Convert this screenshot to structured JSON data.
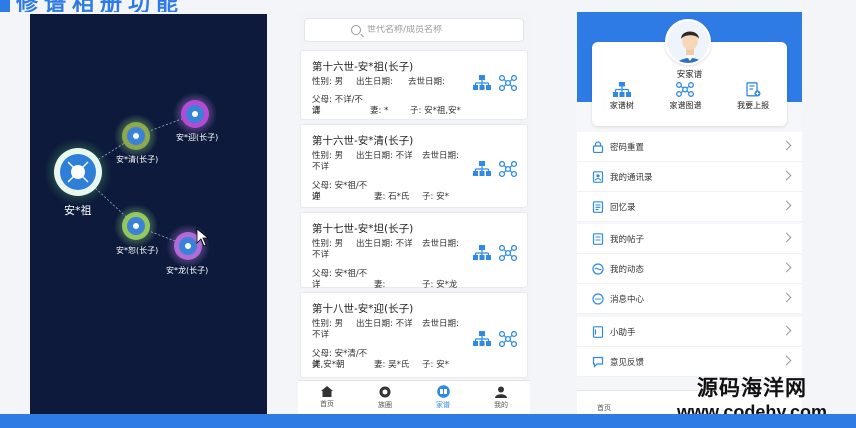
{
  "banner": {
    "title": "修谱相册功能"
  },
  "tree": {
    "nodes": [
      {
        "id": "root",
        "label": "安*祖"
      },
      {
        "id": "n1",
        "label": "安*清(长子)"
      },
      {
        "id": "n2",
        "label": "安*迎(长子)"
      },
      {
        "id": "n3",
        "label": "安*恕(长子)"
      },
      {
        "id": "n4",
        "label": "安*龙(长子)"
      }
    ]
  },
  "search": {
    "placeholder": "世代名称/成员名称"
  },
  "cards": [
    {
      "title": "第十六世-安*祖(长子)",
      "line1": [
        "性别: 男",
        "出生日期:",
        "去世日期:"
      ],
      "line2": [
        "父母: 不详/不详",
        "妻: *",
        "子: 安*祖,安*"
      ],
      "line2b": "清"
    },
    {
      "title": "第十六世-安*清(长子)",
      "line1": [
        "性别: 男",
        "出生日期: 不详",
        "去世日期:"
      ],
      "line1b": "不详",
      "line2": [
        "父母: 安*祖/不详",
        "妻: 石*氏",
        "子: 安*"
      ],
      "line2b": "迎"
    },
    {
      "title": "第十七世-安*坦(长子)",
      "line1": [
        "性别: 男",
        "出生日期: 不详",
        "去世日期:"
      ],
      "line1b": "不详",
      "line2": [
        "父母: 安*祖/不详",
        "妻:",
        "子: 安*龙"
      ]
    },
    {
      "title": "第十八世-安*迎(长子)",
      "line1": [
        "性别: 男",
        "出生日期: 不详",
        "去世日期:"
      ],
      "line1b": "不详",
      "line2": [
        "父母: 安*清/不详",
        "妻: 吴*氏",
        "子: 安*"
      ],
      "line2b": "美,安*朝"
    }
  ],
  "bottom_nav": [
    {
      "label": "首页",
      "icon": "home-icon"
    },
    {
      "label": "族圈",
      "icon": "camera-icon"
    },
    {
      "label": "家谱",
      "icon": "book-icon"
    },
    {
      "label": "我的",
      "icon": "user-icon"
    }
  ],
  "bottom_nav_active": 2,
  "profile": {
    "name": "安家谱",
    "actions": [
      {
        "label": "家谱树",
        "icon": "org-tree-icon"
      },
      {
        "label": "家谱图谱",
        "icon": "network-icon"
      },
      {
        "label": "我要上报",
        "icon": "report-icon"
      }
    ]
  },
  "menu_groups": [
    [
      {
        "label": "密码重置",
        "icon": "lock-icon"
      },
      {
        "label": "我的通讯录",
        "icon": "contacts-icon"
      },
      {
        "label": "回忆录",
        "icon": "memoir-icon"
      }
    ],
    [
      {
        "label": "我的帖子",
        "icon": "post-icon"
      },
      {
        "label": "我的动态",
        "icon": "activity-icon"
      },
      {
        "label": "消息中心",
        "icon": "message-icon"
      }
    ],
    [
      {
        "label": "小助手",
        "icon": "assistant-icon"
      },
      {
        "label": "意见反馈",
        "icon": "feedback-icon"
      }
    ]
  ],
  "right_nav": {
    "first_label": "首页"
  },
  "watermark": {
    "line1": "源码海洋网",
    "line2": "www.codehy.com"
  },
  "colors": {
    "accent": "#2e7be6",
    "tree_bg": "#0d1a3b",
    "icon_blue": "#2e8ae6"
  }
}
